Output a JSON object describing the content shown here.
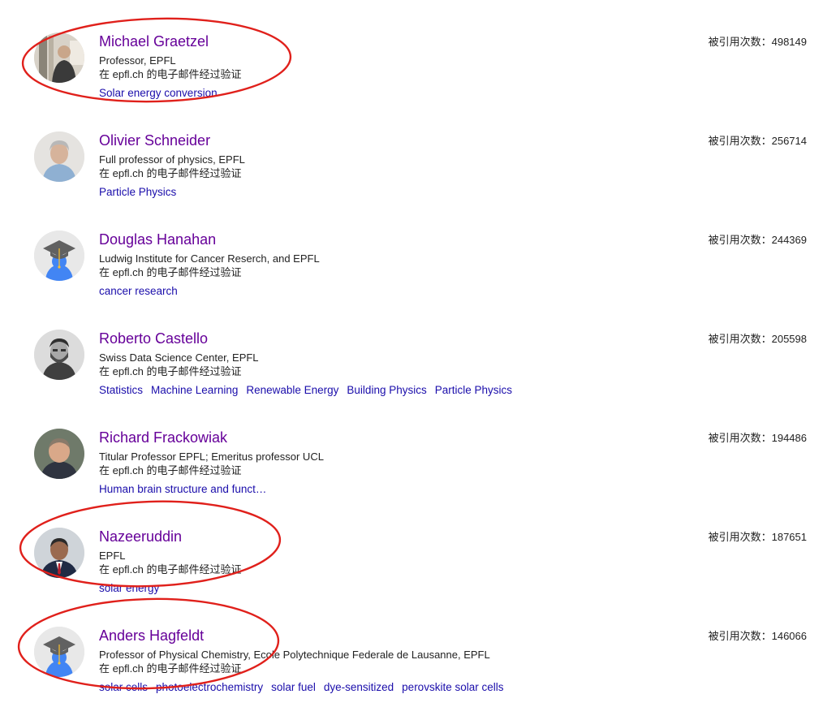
{
  "colors": {
    "name_link": "#660099",
    "interest_link": "#1a0dab",
    "annotation": "#e0201b"
  },
  "citation_label": "被引用次数：",
  "email_verified_text": "在 epfl.ch 的电子邮件经过验证",
  "profiles": [
    {
      "name": "Michael Graetzel",
      "affiliation": "Professor, EPFL",
      "email": "在 epfl.ch 的电子邮件经过验证",
      "citations": "被引用次数：498149",
      "avatar": "photo-man-lab",
      "interests": [
        "Solar energy conversion"
      ]
    },
    {
      "name": "Olivier Schneider",
      "affiliation": "Full professor of physics, EPFL",
      "email": "在 epfl.ch 的电子邮件经过验证",
      "citations": "被引用次数：256714",
      "avatar": "photo-man-grey-hair",
      "interests": [
        "Particle Physics"
      ]
    },
    {
      "name": "Douglas Hanahan",
      "affiliation": "Ludwig Institute for Cancer Reserch, and EPFL",
      "email": "在 epfl.ch 的电子邮件经过验证",
      "citations": "被引用次数：244369",
      "avatar": "default-graduate-cap-icon",
      "interests": [
        "cancer research"
      ]
    },
    {
      "name": "Roberto Castello",
      "affiliation": "Swiss Data Science Center, EPFL",
      "email": "在 epfl.ch 的电子邮件经过验证",
      "citations": "被引用次数：205598",
      "avatar": "photo-man-beard-bw",
      "interests": [
        "Statistics",
        "Machine Learning",
        "Renewable Energy",
        "Building Physics",
        "Particle Physics"
      ]
    },
    {
      "name": "Richard Frackowiak",
      "affiliation": "Titular Professor EPFL; Emeritus professor UCL",
      "email": "在 epfl.ch 的电子邮件经过验证",
      "citations": "被引用次数：194486",
      "avatar": "photo-man-older",
      "interests": [
        "Human brain structure and funct…"
      ]
    },
    {
      "name": "Nazeeruddin",
      "affiliation": "EPFL",
      "email": "在 epfl.ch 的电子邮件经过验证",
      "citations": "被引用次数：187651",
      "avatar": "photo-man-suit",
      "interests": [
        "solar energy"
      ]
    },
    {
      "name": "Anders Hagfeldt",
      "affiliation": "Professor of Physical Chemistry, Ecole Polytechnique Federale de Lausanne, EPFL",
      "email": "在 epfl.ch 的电子邮件经过验证",
      "citations": "被引用次数：146066",
      "avatar": "default-graduate-cap-icon",
      "interests": [
        "solar cells",
        "photoelectrochemistry",
        "solar fuel",
        "dye-sensitized",
        "perovskite solar cells"
      ]
    }
  ]
}
